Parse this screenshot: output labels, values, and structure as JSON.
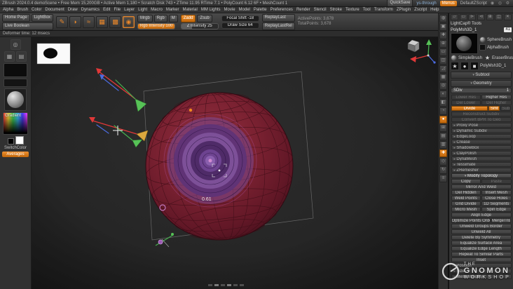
{
  "colors": {
    "accent": "#d9751a",
    "axis_red": "#e03838",
    "axis_green": "#46b04e",
    "axis_blue": "#4b6be0",
    "sphere": "#7a1f2f",
    "purple": "#6e4187"
  },
  "titlebar": {
    "app_info": "ZBrush 2024.0.4 demoScene  •  Free Mem 15,200GB  •  Active Mem 1,180  •  Scratch Disk 743  •  ZTime 11.95  RTime 7.1  •  PolyCount 6.12 6F  •  MeshCount 1",
    "quicksave": "QuickSave",
    "user": "ys-through",
    "menus_button": "Menus",
    "script_name": "DefaultZScript",
    "right_icons": "◉ ◎ ⚙"
  },
  "menubar": {
    "items": [
      "Alpha",
      "Brush",
      "Color",
      "Document",
      "Draw",
      "Dynamics",
      "Edit",
      "File",
      "Layer",
      "Light",
      "Macro",
      "Marker",
      "Material",
      "MM Lights",
      "Movie",
      "Model",
      "Palette",
      "Preferences",
      "Render",
      "Stencil",
      "Stroke",
      "Texture",
      "Tool",
      "Transform",
      "ZPlugin",
      "Zscript",
      "Help"
    ],
    "right_icons": "⊞ ◔ ≡"
  },
  "shelf": {
    "home_page": "Home Page",
    "lightbox": "LightBox",
    "live_boolean": "Live Boolean",
    "tiles": [
      {
        "name": "sculptris-pro-icon",
        "glyph": "✎"
      },
      {
        "name": "brush-picker-icon",
        "glyph": "◗"
      },
      {
        "name": "stroke-picker-icon",
        "glyph": "≈"
      },
      {
        "name": "alpha-picker-icon",
        "glyph": "▦"
      },
      {
        "name": "texture-picker-icon",
        "glyph": "▩"
      },
      {
        "name": "material-picker-icon",
        "glyph": "◉",
        "state": "selected"
      }
    ],
    "mrgb": "Mrgb",
    "rgb": "Rgb",
    "m": "M",
    "rgb_slider": "Rgb Intensity 100",
    "zadd": "Zadd",
    "zsub": "Zsub",
    "z_intensity": "Z Intensity 25",
    "focal_shift": "Focal Shift -18",
    "draw_size": "Draw Size 64",
    "replay_last": "ReplayLast",
    "replay_last_rel": "ReplayLastRel",
    "active_points": "ActivePoints: 3,678",
    "total_points": "TotalPoints: 3,678"
  },
  "statusbar": {
    "deformer": "Deformer time: 12 msecs"
  },
  "left_tray": {
    "gradient_label": "Gradient",
    "switch_color": "SwitchColor",
    "mode_label": "Averages"
  },
  "viewport": {
    "scale_label": "0.61"
  },
  "right_strip": {
    "items": [
      {
        "name": "bpr-icon",
        "glyph": "◍"
      },
      {
        "name": "render-aa-icon",
        "glyph": "▣"
      },
      {
        "name": "scroll-icon",
        "glyph": "✚"
      },
      {
        "name": "zoom-icon",
        "glyph": "⊕"
      },
      {
        "name": "actual-size-icon",
        "glyph": "▭"
      },
      {
        "name": "aa-half-icon",
        "glyph": "◫"
      },
      {
        "name": "persp-icon",
        "glyph": "◿"
      },
      {
        "name": "floor-icon",
        "glyph": "▦"
      },
      {
        "name": "local-icon",
        "glyph": "◎"
      },
      {
        "name": "lsym-icon",
        "glyph": "◐"
      },
      {
        "name": "transp-icon",
        "glyph": "◧"
      },
      {
        "name": "ghost-icon",
        "glyph": "◔"
      },
      {
        "name": "solo-icon",
        "glyph": "●",
        "state": "active"
      },
      {
        "name": "frame-icon",
        "glyph": "⊞"
      },
      {
        "name": "polyframe-icon",
        "glyph": "▤"
      },
      {
        "name": "uv-map-icon",
        "glyph": "▥"
      },
      {
        "name": "move-icon",
        "glyph": "✚",
        "state": "active"
      },
      {
        "name": "scale-icon",
        "glyph": "◇"
      },
      {
        "name": "rotate-icon",
        "glyph": "↻"
      },
      {
        "name": "xyz-icon",
        "glyph": "≡"
      }
    ]
  },
  "tool_panel": {
    "top_icons": [
      {
        "name": "load-tool-icon",
        "glyph": "▱"
      },
      {
        "name": "save-tool-icon",
        "glyph": "▭"
      },
      {
        "name": "import-icon",
        "glyph": "⊳"
      },
      {
        "name": "export-icon",
        "glyph": "⊲"
      },
      {
        "name": "copy-tool-icon",
        "glyph": "⊞"
      },
      {
        "name": "clone-icon",
        "glyph": "◫"
      },
      {
        "name": "delete-icon",
        "glyph": "✕"
      }
    ],
    "title": "LightCap® Tools",
    "tool_name": "PolyMsh3D_1",
    "tool_value": "41",
    "quick_tools": {
      "q1": "SphereBrush",
      "q2": "AlphaBrush",
      "q3": "SimpleBrush",
      "q4": "EraserBrush"
    },
    "current_tool": "PolyMsh3D_1",
    "subtool_header": "Subtool",
    "geometry_header": "Geometry",
    "sdiv_label": "SDiv",
    "sdiv_value": "1",
    "buttons": [
      {
        "label": "Lower Res",
        "state": "dim",
        "w": "half"
      },
      {
        "label": "Higher Res",
        "w": "half"
      },
      {
        "label": "Del Lower",
        "state": "dim",
        "w": "half"
      },
      {
        "label": "Del Higher",
        "state": "dim",
        "w": "half"
      },
      {
        "label": "Divide",
        "state": "active",
        "w": "wide"
      },
      {
        "label": "Smt",
        "state": "active",
        "w": "tiny"
      },
      {
        "label": "Sub",
        "state": "dim",
        "w": "tiny"
      },
      {
        "label": "Reconstruct Subdiv",
        "state": "dim",
        "w": "full"
      },
      {
        "label": "Convert BPR To Geo",
        "state": "dim",
        "w": "full"
      },
      {
        "label": "Proxy Pose",
        "state": "section",
        "w": "full"
      },
      {
        "label": "Dynamic Subdiv",
        "state": "section",
        "w": "full"
      },
      {
        "label": "EdgeLoop",
        "state": "section",
        "w": "full"
      },
      {
        "label": "Crease",
        "state": "section",
        "w": "full"
      },
      {
        "label": "ShadowBox",
        "state": "section",
        "w": "full"
      },
      {
        "label": "ClayPolish",
        "state": "section",
        "w": "full"
      },
      {
        "label": "DynaMesh",
        "state": "section",
        "w": "full"
      },
      {
        "label": "Tessimate",
        "state": "section",
        "w": "full"
      },
      {
        "label": "ZRemesher",
        "state": "section",
        "w": "full"
      },
      {
        "label": "Modify Topology",
        "state": "header",
        "w": "full"
      },
      {
        "label": "Copy",
        "w": "half"
      },
      {
        "label": "Paste",
        "state": "dim",
        "w": "half"
      },
      {
        "label": "Mirror And Weld",
        "w": "full"
      },
      {
        "label": "Del Hidden",
        "w": "half"
      },
      {
        "label": "Insert Mesh",
        "w": "half"
      },
      {
        "label": "Weld Points",
        "w": "half"
      },
      {
        "label": "Close Holes",
        "w": "half"
      },
      {
        "label": "Grid Divide",
        "w": "half"
      },
      {
        "label": "1D Segments",
        "w": "half"
      },
      {
        "label": "Micro Mesh",
        "w": "half"
      },
      {
        "label": "Spin Edge",
        "w": "half"
      },
      {
        "label": "Align Edge",
        "w": "full"
      },
      {
        "label": "Optimize Points Order",
        "w": "wide2"
      },
      {
        "label": "MergeTris",
        "w": "small2"
      },
      {
        "label": "Unweld Groups Border",
        "w": "full"
      },
      {
        "label": "Unweld All",
        "w": "full"
      },
      {
        "label": "Delete By Symmetry",
        "w": "full"
      },
      {
        "label": "Equalize Surface Area",
        "w": "full"
      },
      {
        "label": "Equalize Edge Length",
        "w": "full"
      },
      {
        "label": "Repeat To Similar Parts",
        "w": "full"
      },
      {
        "label": "Inset",
        "w": "full"
      },
      {
        "label": "Position",
        "state": "section",
        "w": "full"
      },
      {
        "label": "Size",
        "state": "section",
        "w": "full"
      },
      {
        "label": "Mesh Integrity",
        "state": "section",
        "w": "full"
      }
    ]
  },
  "watermark": {
    "line1": "THE",
    "line2": "GNOMON",
    "line3": "WORKSHOP"
  }
}
